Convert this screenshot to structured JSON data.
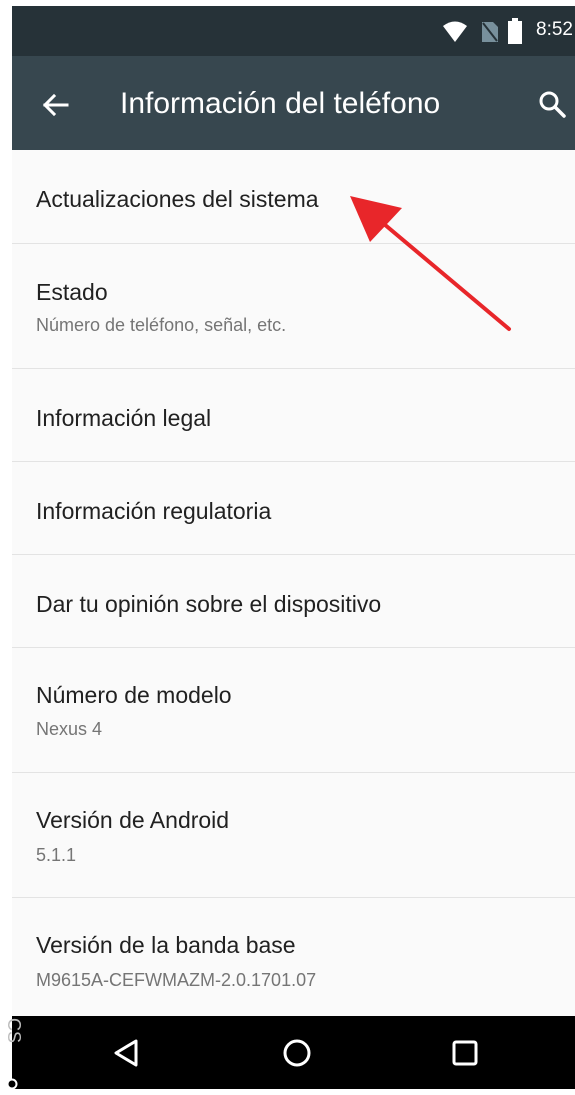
{
  "status_bar": {
    "time": "8:52",
    "icons": [
      "wifi-icon",
      "no-sim-icon",
      "battery-icon"
    ]
  },
  "app_bar": {
    "title": "Información del teléfono",
    "back_icon": "arrow-back-icon",
    "search_icon": "search-icon"
  },
  "settings": {
    "items": [
      {
        "primary": "Actualizaciones del sistema",
        "secondary": ""
      },
      {
        "primary": "Estado",
        "secondary": "Número de teléfono, señal, etc."
      },
      {
        "primary": "Información legal",
        "secondary": ""
      },
      {
        "primary": "Información regulatoria",
        "secondary": ""
      },
      {
        "primary": "Dar tu opinión sobre el dispositivo",
        "secondary": ""
      },
      {
        "primary": "Número de modelo",
        "secondary": "Nexus 4"
      },
      {
        "primary": "Versión de Android",
        "secondary": "5.1.1"
      },
      {
        "primary": "Versión de la banda base",
        "secondary": "M9615A-CEFWMAZM-2.0.1701.07"
      }
    ]
  },
  "nav_bar": {
    "icons": [
      "nav-back-icon",
      "nav-home-icon",
      "nav-recents-icon"
    ]
  },
  "watermark": {
    "text": "CS"
  },
  "colors": {
    "status_bar": "#263238",
    "app_bar": "#37474f",
    "annotation_arrow": "#e8262a"
  }
}
